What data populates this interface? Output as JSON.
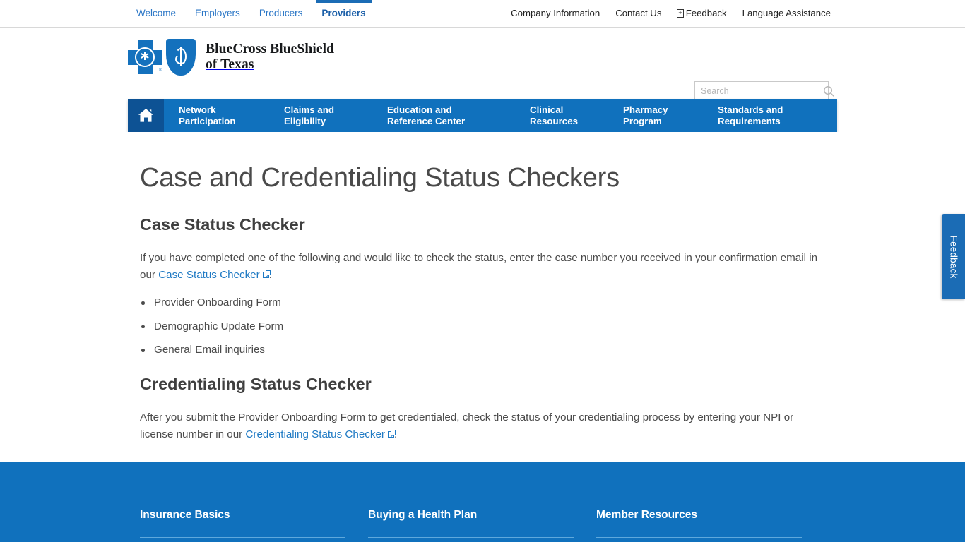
{
  "utility": {
    "audience_tabs": [
      {
        "label": "Welcome",
        "active": false
      },
      {
        "label": "Employers",
        "active": false
      },
      {
        "label": "Producers",
        "active": false
      },
      {
        "label": "Providers",
        "active": true
      }
    ],
    "links": [
      {
        "label": "Company Information",
        "icon": null
      },
      {
        "label": "Contact Us",
        "icon": null
      },
      {
        "label": "Feedback",
        "icon": "plus-box-icon"
      },
      {
        "label": "Language Assistance",
        "icon": null
      }
    ]
  },
  "brand": {
    "logo_line1": "BlueCross BlueShield",
    "logo_line2": "of Texas",
    "logo_alt": "blue-cross-blue-shield-of-texas-logo"
  },
  "search": {
    "placeholder": "Search",
    "value": "",
    "button_icon": "search-icon"
  },
  "mainnav": {
    "home_icon": "home-icon",
    "items": [
      {
        "label": "Network\nParticipation"
      },
      {
        "label": "Claims and\nEligibility"
      },
      {
        "label": "Education and\nReference Center"
      },
      {
        "label": "Clinical\nResources"
      },
      {
        "label": "Pharmacy\nProgram"
      },
      {
        "label": "Standards and\nRequirements"
      }
    ]
  },
  "main": {
    "page_title": "Case and Credentialing Status Checkers",
    "section1": {
      "heading": "Case Status Checker",
      "para_before": "If you have completed one of the following and would like to check the status, enter the case number you received in your confirmation email in our ",
      "link_text": "Case Status Checker",
      "para_after": ":",
      "bullets": [
        "Provider Onboarding Form",
        "Demographic Update Form",
        "General Email inquiries"
      ]
    },
    "section2": {
      "heading": "Credentialing Status Checker",
      "para_before": "After you submit the Provider Onboarding Form to get credentialed, check the status of your credentialing process by entering your NPI or license number in our ",
      "link_text": "Credentialing Status Checker",
      "para_after": "."
    }
  },
  "footer": {
    "columns": [
      {
        "title": "Insurance Basics"
      },
      {
        "title": "Buying a Health Plan"
      },
      {
        "title": "Member Resources"
      }
    ]
  },
  "feedback_tab": {
    "label": "Feedback"
  },
  "colors": {
    "brand_blue": "#1071bd",
    "nav_home_blue": "#0d5294",
    "link_blue": "#1f7ac4",
    "audience_blue": "#2a76c6",
    "footer_rule": "#5ea8dc",
    "text_gray": "#4b4b4b",
    "title_gray": "#4a4a4a"
  }
}
